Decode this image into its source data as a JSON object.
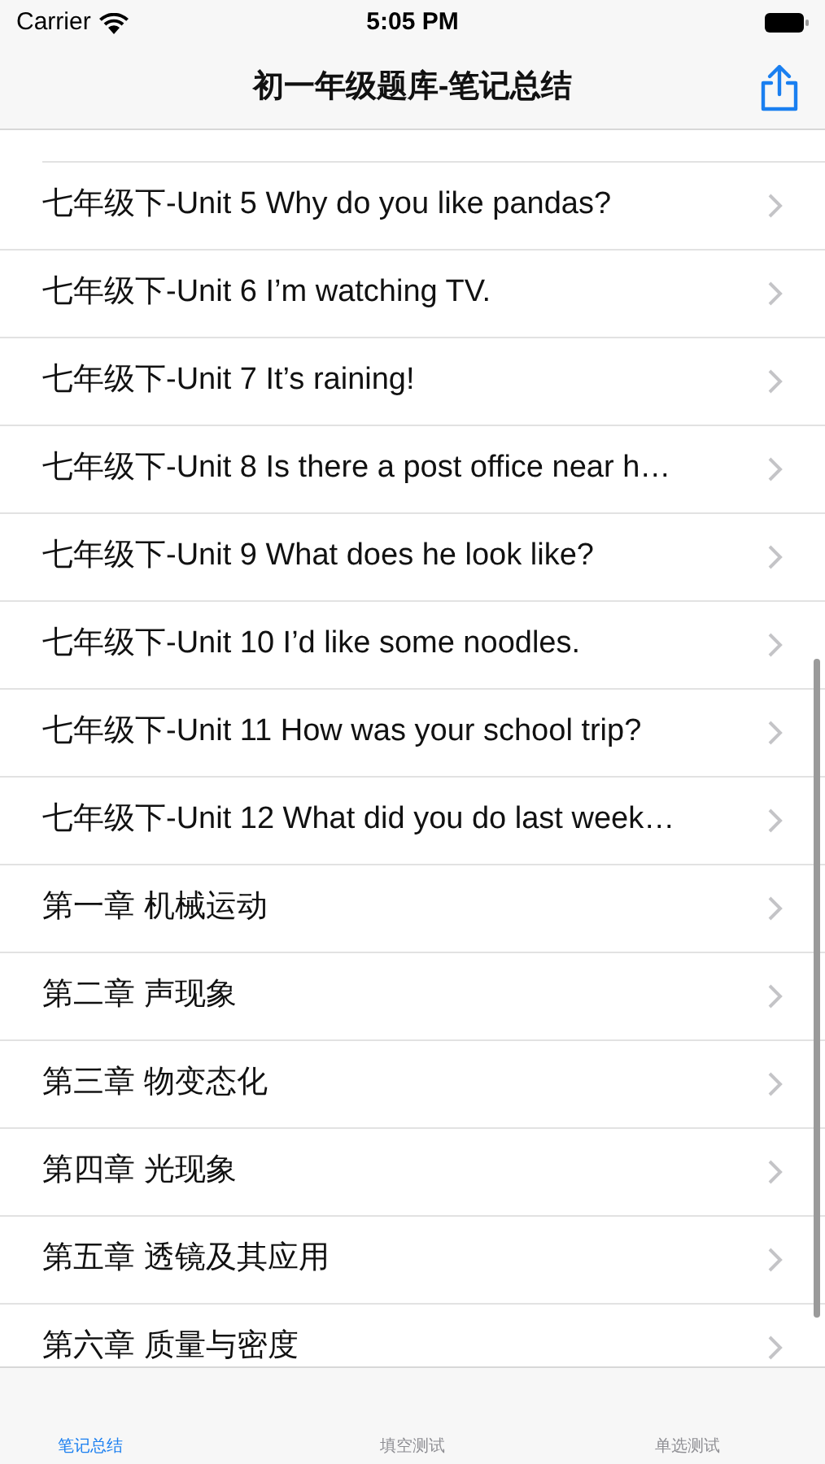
{
  "status_bar": {
    "carrier": "Carrier",
    "time": "5:05 PM"
  },
  "nav": {
    "title": "初一年级题库-笔记总结"
  },
  "list": {
    "items": [
      {
        "label": "七年级下-Unit 5 Why do you like pandas?"
      },
      {
        "label": "七年级下-Unit 6  I’m watching TV."
      },
      {
        "label": "七年级下-Unit 7 It’s raining!"
      },
      {
        "label": "七年级下-Unit 8 Is there a post office near h…"
      },
      {
        "label": "七年级下-Unit 9 What does he look like?"
      },
      {
        "label": "七年级下-Unit 10 I’d like some noodles."
      },
      {
        "label": "七年级下-Unit 11 How was your school trip?"
      },
      {
        "label": "七年级下-Unit 12 What did you do last week…"
      },
      {
        "label": "第一章  机械运动"
      },
      {
        "label": "第二章  声现象"
      },
      {
        "label": "第三章  物变态化"
      },
      {
        "label": "第四章  光现象"
      },
      {
        "label": "第五章  透镜及其应用"
      },
      {
        "label": "第六章  质量与密度"
      }
    ]
  },
  "tab_bar": {
    "tabs": [
      {
        "label": "笔记总结",
        "selected": true
      },
      {
        "label": "填空测试",
        "selected": false
      },
      {
        "label": "单选测试",
        "selected": false
      }
    ]
  }
}
